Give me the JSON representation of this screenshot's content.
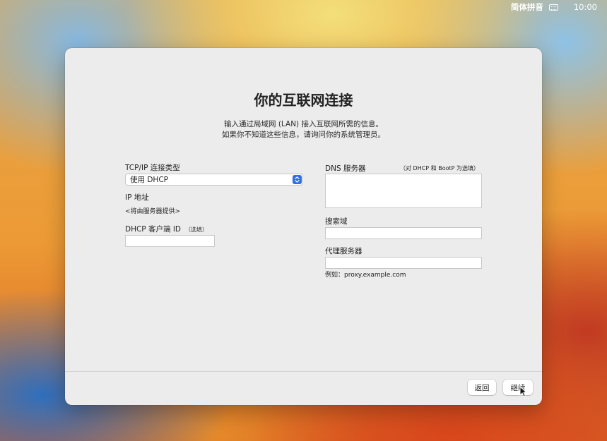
{
  "menubar": {
    "input_method": "简体拼音",
    "input_icon": "keyboard-icon",
    "clock": "10:00"
  },
  "dialog": {
    "title": "你的互联网连接",
    "subtitle_line1": "输入通过局域网 (LAN) 接入互联网所需的信息。",
    "subtitle_line2": "如果你不知道这些信息，请询问你的系统管理员。",
    "left": {
      "tcpip_label": "TCP/IP 连接类型",
      "tcpip_selected": "使用 DHCP",
      "ip_label": "IP 地址",
      "ip_value": "<将由服务器提供>",
      "dhcp_label": "DHCP 客户端 ID",
      "dhcp_hint": "（选填）",
      "dhcp_value": ""
    },
    "right": {
      "dns_label": "DNS 服务器",
      "dns_hint": "（对 DHCP 和 BootP 为选填）",
      "dns_value": "",
      "search_label": "搜索域",
      "search_value": "",
      "proxy_label": "代理服务器",
      "proxy_value": "",
      "proxy_example": "例如：proxy.example.com"
    },
    "buttons": {
      "back": "返回",
      "continue": "继续"
    }
  },
  "colors": {
    "accent": "#2f6fe0",
    "window_bg": "#ececec"
  }
}
